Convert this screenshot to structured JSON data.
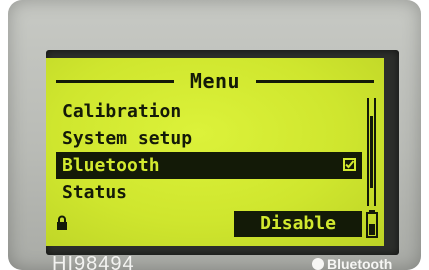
{
  "screen": {
    "title": "Menu",
    "items": [
      {
        "label": "Calibration",
        "selected": false
      },
      {
        "label": "System setup",
        "selected": false
      },
      {
        "label": "Bluetooth",
        "selected": true,
        "checked": true
      },
      {
        "label": "Status",
        "selected": false
      }
    ],
    "softkey_label": "Disable",
    "icons": {
      "lock": "lock-icon",
      "battery": "battery-icon",
      "checkbox": "checkbox-checked-icon"
    }
  },
  "device": {
    "model_label": "HI98494",
    "brand_label": "Bluetooth"
  },
  "colors": {
    "lcd_background": "#d4ea33",
    "lcd_ink": "#141a08",
    "device_body": "#bdbfba",
    "bezel": "#2c2e2b"
  }
}
